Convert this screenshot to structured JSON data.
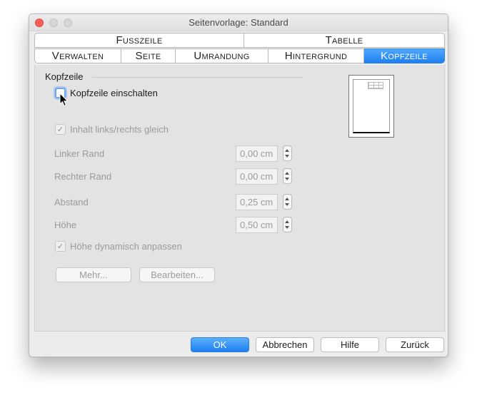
{
  "window": {
    "title": "Seitenvorlage: Standard"
  },
  "tabs": {
    "row1": [
      {
        "label": "Fusszeile"
      },
      {
        "label": "Tabelle"
      }
    ],
    "row2": [
      {
        "label": "Verwalten"
      },
      {
        "label": "Seite"
      },
      {
        "label": "Umrandung"
      },
      {
        "label": "Hintergrund"
      },
      {
        "label": "Kopfzeile",
        "active": true
      }
    ]
  },
  "header_section": {
    "title": "Kopfzeile",
    "enable_checkbox": {
      "label": "Kopfzeile einschalten",
      "checked": false
    },
    "same_content_checkbox": {
      "label": "Inhalt links/rechts gleich",
      "checked": true,
      "check_glyph": "✓"
    },
    "fields": {
      "left_margin": {
        "label": "Linker Rand",
        "value": "0,00 cm"
      },
      "right_margin": {
        "label": "Rechter Rand",
        "value": "0,00 cm"
      },
      "spacing": {
        "label": "Abstand",
        "value": "0,25 cm"
      },
      "height": {
        "label": "Höhe",
        "value": "0,50 cm"
      }
    },
    "autofit_checkbox": {
      "label": "Höhe dynamisch anpassen",
      "checked": true,
      "check_glyph": "✓"
    },
    "more_button": "Mehr...",
    "edit_button": "Bearbeiten..."
  },
  "footer": {
    "ok": "OK",
    "cancel": "Abbrechen",
    "help": "Hilfe",
    "reset": "Zurück"
  },
  "colors": {
    "accent": "#1f7ef2",
    "close": "#fc5f57"
  }
}
